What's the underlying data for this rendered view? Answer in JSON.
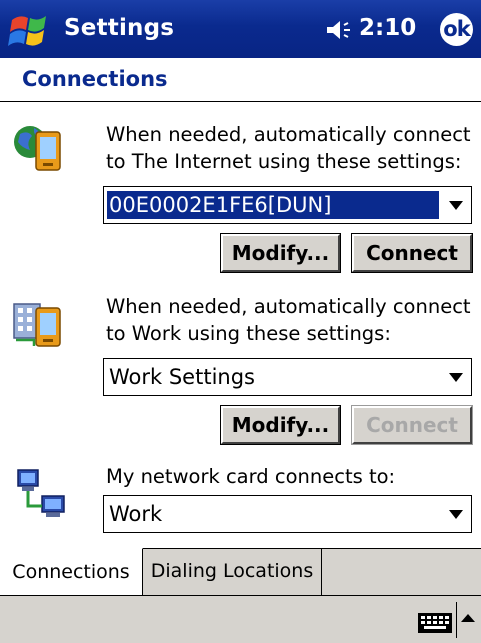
{
  "titlebar": {
    "title": "Settings",
    "time": "2:10",
    "ok_label": "ok"
  },
  "page": {
    "title": "Connections"
  },
  "internet": {
    "description_line1": "When needed, automatically connect",
    "description_line2": "to The Internet using these settings:",
    "selected_value": "00E0002E1FE6[DUN]",
    "modify_label": "Modify...",
    "connect_label": "Connect"
  },
  "work": {
    "description_line1": "When needed, automatically connect",
    "description_line2": "to Work using these settings:",
    "selected_value": "Work Settings",
    "modify_label": "Modify...",
    "connect_label": "Connect"
  },
  "network_card": {
    "description": "My network card connects to:",
    "selected_value": "Work"
  },
  "tabs": [
    {
      "label": "Connections",
      "active": true
    },
    {
      "label": "Dialing Locations",
      "active": false
    }
  ],
  "icons": {
    "start": "windows-flag-icon",
    "sound": "speaker-icon",
    "internet": "globe-pda-icon",
    "work": "building-pda-icon",
    "network": "network-computers-icon",
    "keyboard": "keyboard-icon",
    "sip": "sip-arrow-icon"
  },
  "colors": {
    "titlebar": "#0a2a8e",
    "selection": "#0a2a8e",
    "button_face": "#d6d3ce",
    "disabled_text": "#a8a8a8"
  }
}
